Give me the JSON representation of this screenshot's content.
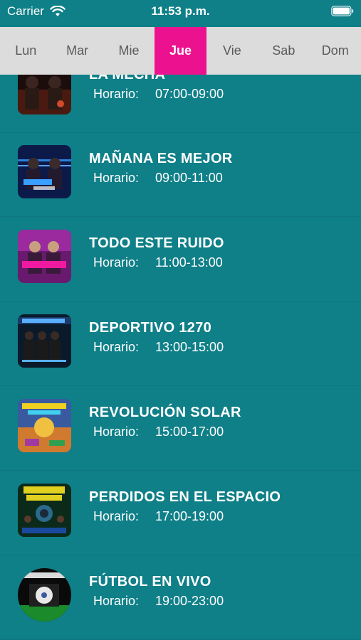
{
  "status": {
    "carrier": "Carrier",
    "time": "11:53 p.m."
  },
  "days": [
    "Lun",
    "Mar",
    "Mie",
    "Jue",
    "Vie",
    "Sab",
    "Dom"
  ],
  "selected_day": "Jue",
  "horario_label": "Horario:",
  "programs": [
    {
      "title": "LA MECHA",
      "time": "07:00-09:00"
    },
    {
      "title": "MAÑANA ES MEJOR",
      "time": "09:00-11:00"
    },
    {
      "title": "TODO ESTE RUIDO",
      "time": "11:00-13:00"
    },
    {
      "title": "DEPORTIVO 1270",
      "time": "13:00-15:00"
    },
    {
      "title": "REVOLUCIÓN SOLAR",
      "time": "15:00-17:00"
    },
    {
      "title": "PERDIDOS EN EL ESPACIO",
      "time": "17:00-19:00"
    },
    {
      "title": "FÚTBOL EN VIVO",
      "time": "19:00-23:00"
    }
  ],
  "colors": {
    "background": "#0f7f88",
    "active_day": "#ec128f",
    "daybar": "#dcdcdc"
  }
}
